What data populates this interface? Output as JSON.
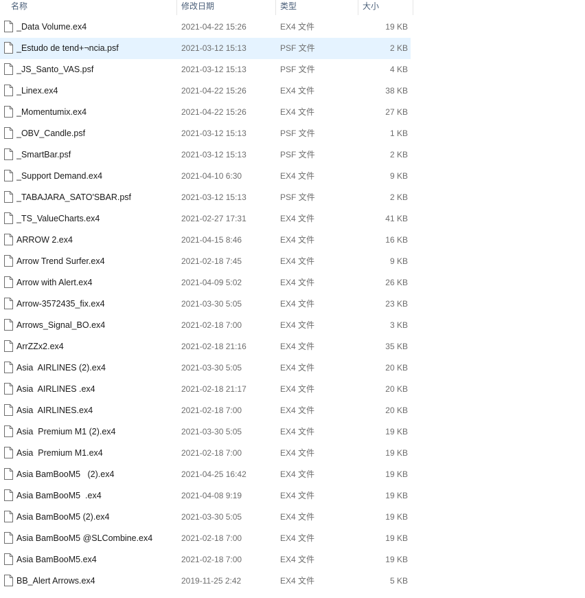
{
  "columns": {
    "name": "名称",
    "date": "修改日期",
    "type": "类型",
    "size": "大小"
  },
  "files": [
    {
      "name": "_Data Volume.ex4",
      "date": "2021-04-22 15:26",
      "type": "EX4 文件",
      "size": "19 KB"
    },
    {
      "name": "_Estudo de tend+¬ncia.psf",
      "date": "2021-03-12 15:13",
      "type": "PSF 文件",
      "size": "2 KB",
      "selected": true
    },
    {
      "name": "_JS_Santo_VAS.psf",
      "date": "2021-03-12 15:13",
      "type": "PSF 文件",
      "size": "4 KB"
    },
    {
      "name": "_Linex.ex4",
      "date": "2021-04-22 15:26",
      "type": "EX4 文件",
      "size": "38 KB"
    },
    {
      "name": "_Momentumix.ex4",
      "date": "2021-04-22 15:26",
      "type": "EX4 文件",
      "size": "27 KB"
    },
    {
      "name": "_OBV_Candle.psf",
      "date": "2021-03-12 15:13",
      "type": "PSF 文件",
      "size": "1 KB"
    },
    {
      "name": "_SmartBar.psf",
      "date": "2021-03-12 15:13",
      "type": "PSF 文件",
      "size": "2 KB"
    },
    {
      "name": "_Support Demand.ex4",
      "date": "2021-04-10 6:30",
      "type": "EX4 文件",
      "size": "9 KB"
    },
    {
      "name": "_TABAJARA_SATO'SBAR.psf",
      "date": "2021-03-12 15:13",
      "type": "PSF 文件",
      "size": "2 KB"
    },
    {
      "name": "_TS_ValueCharts.ex4",
      "date": "2021-02-27 17:31",
      "type": "EX4 文件",
      "size": "41 KB"
    },
    {
      "name": "ARROW 2.ex4",
      "date": "2021-04-15 8:46",
      "type": "EX4 文件",
      "size": "16 KB"
    },
    {
      "name": "Arrow Trend Surfer.ex4",
      "date": "2021-02-18 7:45",
      "type": "EX4 文件",
      "size": "9 KB"
    },
    {
      "name": "Arrow with Alert.ex4",
      "date": "2021-04-09 5:02",
      "type": "EX4 文件",
      "size": "26 KB"
    },
    {
      "name": "Arrow-3572435_fix.ex4",
      "date": "2021-03-30 5:05",
      "type": "EX4 文件",
      "size": "23 KB"
    },
    {
      "name": "Arrows_Signal_BO.ex4",
      "date": "2021-02-18 7:00",
      "type": "EX4 文件",
      "size": "3 KB"
    },
    {
      "name": "ArrZZx2.ex4",
      "date": "2021-02-18 21:16",
      "type": "EX4 文件",
      "size": "35 KB"
    },
    {
      "name": "Asia  AIRLINES (2).ex4",
      "date": "2021-03-30 5:05",
      "type": "EX4 文件",
      "size": "20 KB"
    },
    {
      "name": "Asia  AIRLINES .ex4",
      "date": "2021-02-18 21:17",
      "type": "EX4 文件",
      "size": "20 KB"
    },
    {
      "name": "Asia  AIRLINES.ex4",
      "date": "2021-02-18 7:00",
      "type": "EX4 文件",
      "size": "20 KB"
    },
    {
      "name": "Asia  Premium M1 (2).ex4",
      "date": "2021-03-30 5:05",
      "type": "EX4 文件",
      "size": "19 KB"
    },
    {
      "name": "Asia  Premium M1.ex4",
      "date": "2021-02-18 7:00",
      "type": "EX4 文件",
      "size": "19 KB"
    },
    {
      "name": "Asia BamBooM5   (2).ex4",
      "date": "2021-04-25 16:42",
      "type": "EX4 文件",
      "size": "19 KB"
    },
    {
      "name": "Asia BamBooM5  .ex4",
      "date": "2021-04-08 9:19",
      "type": "EX4 文件",
      "size": "19 KB"
    },
    {
      "name": "Asia BamBooM5 (2).ex4",
      "date": "2021-03-30 5:05",
      "type": "EX4 文件",
      "size": "19 KB"
    },
    {
      "name": "Asia BamBooM5 @SLCombine.ex4",
      "date": "2021-02-18 7:00",
      "type": "EX4 文件",
      "size": "19 KB"
    },
    {
      "name": "Asia BamBooM5.ex4",
      "date": "2021-02-18 7:00",
      "type": "EX4 文件",
      "size": "19 KB"
    },
    {
      "name": "BB_Alert Arrows.ex4",
      "date": "2019-11-25 2:42",
      "type": "EX4 文件",
      "size": "5 KB"
    }
  ]
}
